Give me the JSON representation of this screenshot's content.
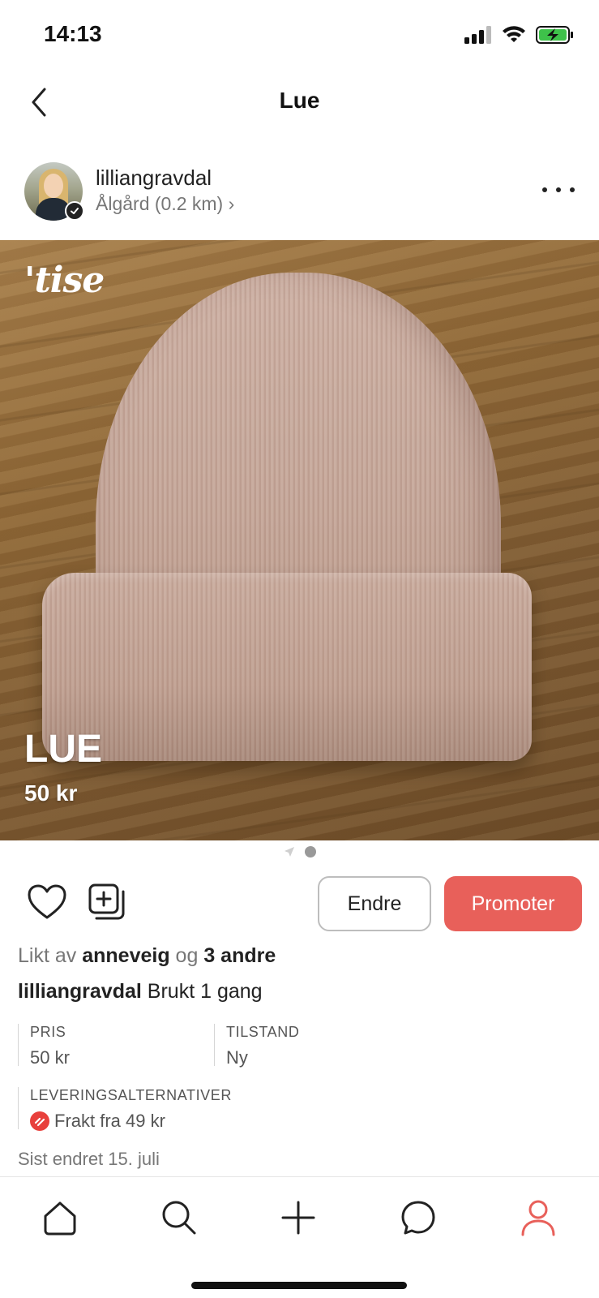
{
  "status_bar": {
    "time": "14:13"
  },
  "nav": {
    "title": "Lue"
  },
  "seller": {
    "username": "lilliangravdal",
    "location": "Ålgård (0.2 km) ›"
  },
  "photo": {
    "brand": "'tise",
    "title": "LUE",
    "price": "50 kr"
  },
  "actions": {
    "edit_label": "Endre",
    "promote_label": "Promoter"
  },
  "likes": {
    "prefix": "Likt av",
    "user": "anneveig",
    "connector": "og",
    "others": "3 andre"
  },
  "caption": {
    "username": "lilliangravdal",
    "text": "Brukt 1 gang"
  },
  "attributes": {
    "price_label": "PRIS",
    "price_value": "50 kr",
    "condition_label": "TILSTAND",
    "condition_value": "Ny",
    "delivery_label": "LEVERINGSALTERNATIVER",
    "delivery_value": "Frakt fra 49 kr"
  },
  "last_edited": "Sist endret 15. juli",
  "colors": {
    "accent": "#e8605a",
    "shipping_icon": "#e8403c",
    "active_tab": "#e8605a"
  },
  "tab_bar": {
    "tabs": [
      "home-icon",
      "search-icon",
      "plus-icon",
      "chat-icon",
      "profile-icon"
    ],
    "active": "profile-icon"
  }
}
